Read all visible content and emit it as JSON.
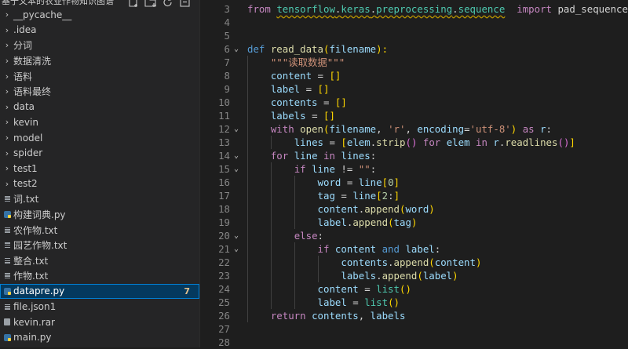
{
  "sidebar": {
    "title": "基于文本的农业作物知识图谱",
    "actions": [
      "new-file-icon",
      "new-folder-icon",
      "refresh-icon",
      "collapse-all-icon"
    ],
    "items": [
      {
        "kind": "folder",
        "label": "__pycache__"
      },
      {
        "kind": "folder",
        "label": ".idea"
      },
      {
        "kind": "folder",
        "label": "分词"
      },
      {
        "kind": "folder",
        "label": "数据清洗"
      },
      {
        "kind": "folder",
        "label": "语料"
      },
      {
        "kind": "folder",
        "label": "语料最终"
      },
      {
        "kind": "folder",
        "label": "data"
      },
      {
        "kind": "folder",
        "label": "kevin"
      },
      {
        "kind": "folder",
        "label": "model"
      },
      {
        "kind": "folder",
        "label": "spider"
      },
      {
        "kind": "folder",
        "label": "test1"
      },
      {
        "kind": "folder",
        "label": "test2"
      },
      {
        "kind": "txt",
        "label": "词.txt"
      },
      {
        "kind": "py",
        "label": "构建词典.py"
      },
      {
        "kind": "txt",
        "label": "农作物.txt"
      },
      {
        "kind": "txt",
        "label": "园艺作物.txt"
      },
      {
        "kind": "txt",
        "label": "整合.txt"
      },
      {
        "kind": "txt",
        "label": "作物.txt"
      },
      {
        "kind": "py",
        "label": "datapre.py",
        "badge": "7",
        "selected": true
      },
      {
        "kind": "json",
        "label": "file.json1"
      },
      {
        "kind": "rar",
        "label": "kevin.rar"
      },
      {
        "kind": "py",
        "label": "main.py"
      }
    ]
  },
  "editor": {
    "lines": [
      {
        "n": "3",
        "fold": "",
        "tokens": [
          [
            "kwc",
            "from "
          ],
          [
            "squig ns",
            "tensorflow"
          ],
          [
            "squig",
            "."
          ],
          [
            "squig ns",
            "keras"
          ],
          [
            "squig",
            "."
          ],
          [
            "squig ns",
            "preprocessing"
          ],
          [
            "squig",
            "."
          ],
          [
            "squig ns",
            "sequence"
          ],
          [
            "",
            "  "
          ],
          [
            "kwc",
            "import "
          ],
          [
            "",
            "pad_sequences"
          ]
        ]
      },
      {
        "n": "4",
        "fold": "",
        "tokens": []
      },
      {
        "n": "5",
        "fold": "",
        "tokens": []
      },
      {
        "n": "6",
        "fold": "⌄",
        "tokens": [
          [
            "kw",
            "def "
          ],
          [
            "fn",
            "read_data"
          ],
          [
            "br1",
            "("
          ],
          [
            "var",
            "filename"
          ],
          [
            "br1",
            "):"
          ]
        ]
      },
      {
        "n": "7",
        "fold": "",
        "tokens": [
          [
            "",
            "    "
          ],
          [
            "str",
            "\"\"\"读取数据\"\"\""
          ]
        ]
      },
      {
        "n": "8",
        "fold": "",
        "tokens": [
          [
            "",
            "    "
          ],
          [
            "var",
            "content"
          ],
          [
            "",
            " = "
          ],
          [
            "br1",
            "[]"
          ]
        ]
      },
      {
        "n": "9",
        "fold": "",
        "tokens": [
          [
            "",
            "    "
          ],
          [
            "var",
            "label"
          ],
          [
            "",
            " = "
          ],
          [
            "br1",
            "[]"
          ]
        ]
      },
      {
        "n": "10",
        "fold": "",
        "tokens": [
          [
            "",
            "    "
          ],
          [
            "var",
            "contents"
          ],
          [
            "",
            " = "
          ],
          [
            "br1",
            "[]"
          ]
        ]
      },
      {
        "n": "11",
        "fold": "",
        "tokens": [
          [
            "",
            "    "
          ],
          [
            "var",
            "labels"
          ],
          [
            "",
            " = "
          ],
          [
            "br1",
            "[]"
          ]
        ]
      },
      {
        "n": "12",
        "fold": "⌄",
        "tokens": [
          [
            "",
            "    "
          ],
          [
            "kwc",
            "with "
          ],
          [
            "fn",
            "open"
          ],
          [
            "br1",
            "("
          ],
          [
            "var",
            "filename"
          ],
          [
            "",
            ", "
          ],
          [
            "str",
            "'r'"
          ],
          [
            "",
            ", "
          ],
          [
            "var",
            "encoding"
          ],
          [
            "",
            "="
          ],
          [
            "str",
            "'utf-8'"
          ],
          [
            "br1",
            ")"
          ],
          [
            "kwc",
            " as "
          ],
          [
            "var",
            "r"
          ],
          [
            "",
            ":"
          ]
        ]
      },
      {
        "n": "13",
        "fold": "",
        "tokens": [
          [
            "",
            "        "
          ],
          [
            "var",
            "lines"
          ],
          [
            "",
            " = "
          ],
          [
            "br1",
            "["
          ],
          [
            "var",
            "elem"
          ],
          [
            "",
            "."
          ],
          [
            "fn",
            "strip"
          ],
          [
            "br2",
            "()"
          ],
          [
            "kwc",
            " for "
          ],
          [
            "var",
            "elem"
          ],
          [
            "kwc",
            " in "
          ],
          [
            "var",
            "r"
          ],
          [
            "",
            "."
          ],
          [
            "fn",
            "readlines"
          ],
          [
            "br2",
            "()"
          ],
          [
            "br1",
            "]"
          ]
        ]
      },
      {
        "n": "14",
        "fold": "⌄",
        "tokens": [
          [
            "",
            "    "
          ],
          [
            "kwc",
            "for "
          ],
          [
            "var",
            "line"
          ],
          [
            "kwc",
            " in "
          ],
          [
            "var",
            "lines"
          ],
          [
            "",
            ":"
          ]
        ]
      },
      {
        "n": "15",
        "fold": "⌄",
        "tokens": [
          [
            "",
            "        "
          ],
          [
            "kwc",
            "if "
          ],
          [
            "var",
            "line"
          ],
          [
            "",
            " != "
          ],
          [
            "str",
            "\"\""
          ],
          [
            "",
            ":"
          ]
        ]
      },
      {
        "n": "16",
        "fold": "",
        "tokens": [
          [
            "",
            "            "
          ],
          [
            "var",
            "word"
          ],
          [
            "",
            " = "
          ],
          [
            "var",
            "line"
          ],
          [
            "br1",
            "["
          ],
          [
            "num",
            "0"
          ],
          [
            "br1",
            "]"
          ]
        ]
      },
      {
        "n": "17",
        "fold": "",
        "tokens": [
          [
            "",
            "            "
          ],
          [
            "var",
            "tag"
          ],
          [
            "",
            " = "
          ],
          [
            "var",
            "line"
          ],
          [
            "br1",
            "["
          ],
          [
            "num",
            "2"
          ],
          [
            "",
            ":"
          ],
          [
            "br1",
            "]"
          ]
        ]
      },
      {
        "n": "18",
        "fold": "",
        "tokens": [
          [
            "",
            "            "
          ],
          [
            "var",
            "content"
          ],
          [
            "",
            "."
          ],
          [
            "fn",
            "append"
          ],
          [
            "br1",
            "("
          ],
          [
            "var",
            "word"
          ],
          [
            "br1",
            ")"
          ]
        ]
      },
      {
        "n": "19",
        "fold": "",
        "tokens": [
          [
            "",
            "            "
          ],
          [
            "var",
            "label"
          ],
          [
            "",
            "."
          ],
          [
            "fn",
            "append"
          ],
          [
            "br1",
            "("
          ],
          [
            "var",
            "tag"
          ],
          [
            "br1",
            ")"
          ]
        ]
      },
      {
        "n": "20",
        "fold": "⌄",
        "tokens": [
          [
            "",
            "        "
          ],
          [
            "kwc",
            "else"
          ],
          [
            "",
            ":"
          ]
        ]
      },
      {
        "n": "21",
        "fold": "⌄",
        "tokens": [
          [
            "",
            "            "
          ],
          [
            "kwc",
            "if "
          ],
          [
            "var",
            "content"
          ],
          [
            "kw",
            " and "
          ],
          [
            "var",
            "label"
          ],
          [
            "",
            ":"
          ]
        ]
      },
      {
        "n": "22",
        "fold": "",
        "tokens": [
          [
            "",
            "                "
          ],
          [
            "var",
            "contents"
          ],
          [
            "",
            "."
          ],
          [
            "fn",
            "append"
          ],
          [
            "br1",
            "("
          ],
          [
            "var",
            "content"
          ],
          [
            "br1",
            ")"
          ]
        ]
      },
      {
        "n": "23",
        "fold": "",
        "tokens": [
          [
            "",
            "                "
          ],
          [
            "var",
            "labels"
          ],
          [
            "",
            "."
          ],
          [
            "fn",
            "append"
          ],
          [
            "br1",
            "("
          ],
          [
            "var",
            "label"
          ],
          [
            "br1",
            ")"
          ]
        ]
      },
      {
        "n": "24",
        "fold": "",
        "tokens": [
          [
            "",
            "            "
          ],
          [
            "var",
            "content"
          ],
          [
            "",
            " = "
          ],
          [
            "ns",
            "list"
          ],
          [
            "br1",
            "()"
          ]
        ]
      },
      {
        "n": "25",
        "fold": "",
        "tokens": [
          [
            "",
            "            "
          ],
          [
            "var",
            "label"
          ],
          [
            "",
            " = "
          ],
          [
            "ns",
            "list"
          ],
          [
            "br1",
            "()"
          ]
        ]
      },
      {
        "n": "26",
        "fold": "",
        "tokens": [
          [
            "",
            "    "
          ],
          [
            "kwc",
            "return "
          ],
          [
            "var",
            "contents"
          ],
          [
            "",
            ", "
          ],
          [
            "var",
            "labels"
          ]
        ]
      },
      {
        "n": "27",
        "fold": "",
        "tokens": []
      },
      {
        "n": "28",
        "fold": "",
        "tokens": []
      }
    ]
  }
}
